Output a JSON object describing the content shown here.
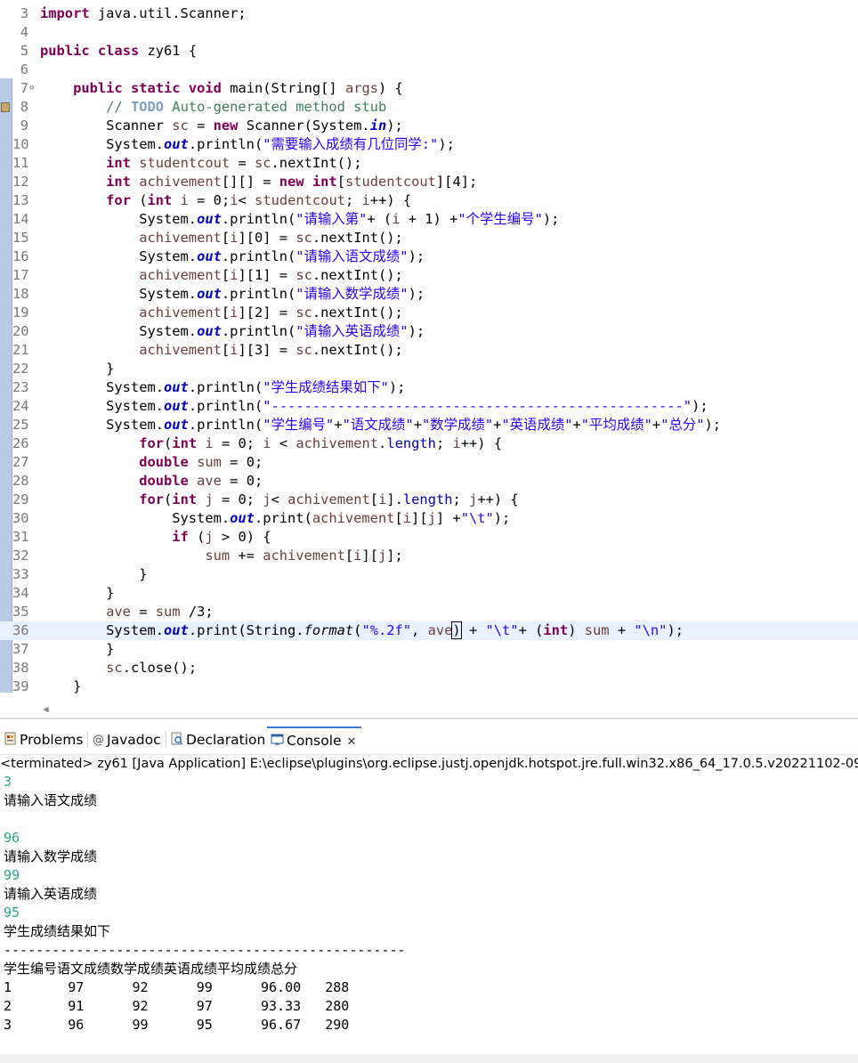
{
  "editor": {
    "lines": [
      {
        "n": "3",
        "html": "<span class=\"kw\">import</span> java.util.Scanner;"
      },
      {
        "n": "4",
        "html": ""
      },
      {
        "n": "5",
        "html": "<span class=\"kw\">public</span> <span class=\"kw\">class</span> zy61 {"
      },
      {
        "n": "6",
        "html": ""
      },
      {
        "n": "7",
        "fold": true,
        "html": "    <span class=\"kw\">public</span> <span class=\"kw\">static</span> <span class=\"kw\">void</span> main(String[] <span class=\"var\">args</span>) {"
      },
      {
        "n": "8",
        "marker": true,
        "html": "        <span class=\"cm\">// </span><span class=\"todo\">TODO</span><span class=\"cm\"> Auto-generated method stub</span>"
      },
      {
        "n": "9",
        "html": "        Scanner <span class=\"var\">sc</span> = <span class=\"kw\">new</span> Scanner(System.<span class=\"sfld\">in</span>);"
      },
      {
        "n": "10",
        "html": "        System.<span class=\"sfld\">out</span>.println(<span class=\"str\">\"需要输入成绩有几位同学:\"</span>);"
      },
      {
        "n": "11",
        "html": "        <span class=\"kw\">int</span> <span class=\"var\">studentcout</span> = <span class=\"var\">sc</span>.nextInt();"
      },
      {
        "n": "12",
        "html": "        <span class=\"kw\">int</span> <span class=\"var\">achivement</span>[][] = <span class=\"kw\">new</span> <span class=\"kw\">int</span>[<span class=\"var\">studentcout</span>][4];"
      },
      {
        "n": "13",
        "html": "        <span class=\"kw\">for</span> (<span class=\"kw\">int</span> <span class=\"var\">i</span> = 0;<span class=\"var\">i</span>&lt; <span class=\"var\">studentcout</span>; <span class=\"var\">i</span>++) {"
      },
      {
        "n": "14",
        "html": "            System.<span class=\"sfld\">out</span>.println(<span class=\"str\">\"请输入第\"</span>+ (<span class=\"var\">i</span> + 1) +<span class=\"str\">\"个学生编号\"</span>);"
      },
      {
        "n": "15",
        "html": "            <span class=\"var\">achivement</span>[<span class=\"var\">i</span>][0] = <span class=\"var\">sc</span>.nextInt();"
      },
      {
        "n": "16",
        "html": "            System.<span class=\"sfld\">out</span>.println(<span class=\"str\">\"请输入语文成绩\"</span>);"
      },
      {
        "n": "17",
        "html": "            <span class=\"var\">achivement</span>[<span class=\"var\">i</span>][1] = <span class=\"var\">sc</span>.nextInt();"
      },
      {
        "n": "18",
        "html": "            System.<span class=\"sfld\">out</span>.println(<span class=\"str\">\"请输入数学成绩\"</span>);"
      },
      {
        "n": "19",
        "html": "            <span class=\"var\">achivement</span>[<span class=\"var\">i</span>][2] = <span class=\"var\">sc</span>.nextInt();"
      },
      {
        "n": "20",
        "html": "            System.<span class=\"sfld\">out</span>.println(<span class=\"str\">\"请输入英语成绩\"</span>);"
      },
      {
        "n": "21",
        "html": "            <span class=\"var\">achivement</span>[<span class=\"var\">i</span>][3] = <span class=\"var\">sc</span>.nextInt();"
      },
      {
        "n": "22",
        "html": "        }"
      },
      {
        "n": "23",
        "html": "        System.<span class=\"sfld\">out</span>.println(<span class=\"str\">\"学生成绩结果如下\"</span>);"
      },
      {
        "n": "24",
        "html": "        System.<span class=\"sfld\">out</span>.println(<span class=\"str\">\"--------------------------------------------------\"</span>);"
      },
      {
        "n": "25",
        "html": "        System.<span class=\"sfld\">out</span>.println(<span class=\"str\">\"学生编号\"</span>+<span class=\"str\">\"语文成绩\"</span>+<span class=\"str\">\"数学成绩\"</span>+<span class=\"str\">\"英语成绩\"</span>+<span class=\"str\">\"平均成绩\"</span>+<span class=\"str\">\"总分\"</span>);"
      },
      {
        "n": "26",
        "html": "            <span class=\"kw\">for</span>(<span class=\"kw\">int</span> <span class=\"var\">i</span> = 0; <span class=\"var\">i</span> &lt; <span class=\"var\">achivement</span>.<span class=\"fld\">length</span>; <span class=\"var\">i</span>++) {"
      },
      {
        "n": "27",
        "html": "            <span class=\"kw\">double</span> <span class=\"var\">sum</span> = 0;"
      },
      {
        "n": "28",
        "html": "            <span class=\"kw\">double</span> <span class=\"var\">ave</span> = 0;"
      },
      {
        "n": "29",
        "html": "            <span class=\"kw\">for</span>(<span class=\"kw\">int</span> <span class=\"var\">j</span> = 0; <span class=\"var\">j</span>&lt; <span class=\"var\">achivement</span>[<span class=\"var\">i</span>].<span class=\"fld\">length</span>; <span class=\"var\">j</span>++) {"
      },
      {
        "n": "30",
        "html": "                System.<span class=\"sfld\">out</span>.print(<span class=\"var\">achivement</span>[<span class=\"var\">i</span>][<span class=\"var\">j</span>] +<span class=\"str\">\"\\t\"</span>);"
      },
      {
        "n": "31",
        "html": "                <span class=\"kw\">if</span> (<span class=\"var\">j</span> &gt; 0) {"
      },
      {
        "n": "32",
        "html": "                    <span class=\"var\">sum</span> += <span class=\"var\">achivement</span>[<span class=\"var\">i</span>][<span class=\"var\">j</span>];"
      },
      {
        "n": "33",
        "html": "            }"
      },
      {
        "n": "34",
        "html": "        }"
      },
      {
        "n": "35",
        "html": "        <span class=\"var\">ave</span> = <span class=\"var\">sum</span> /3;"
      },
      {
        "n": "36",
        "current": true,
        "html": "        System.<span class=\"sfld\">out</span>.print(String.<span class=\"smeth\">format</span>(<span class=\"str\">\"%.2f\"</span>, <span class=\"var\">ave</span><span class=\"caret\">)</span> + <span class=\"str\">\"\\t\"</span>+ (<span class=\"kw\">int</span>) <span class=\"var\">sum</span> + <span class=\"str\">\"\\n\"</span>);"
      },
      {
        "n": "37",
        "html": "        }"
      },
      {
        "n": "38",
        "html": "        <span class=\"var\">sc</span>.close();"
      },
      {
        "n": "39",
        "html": "    }"
      }
    ]
  },
  "tabs": {
    "problems": "Problems",
    "javadoc": "Javadoc",
    "declaration": "Declaration",
    "console": "Console",
    "close_glyph": "✕",
    "javadoc_glyph": "@"
  },
  "console": {
    "header": "<terminated> zy61 [Java Application] E:\\eclipse\\plugins\\org.eclipse.justj.openjdk.hotspot.jre.full.win32.x86_64_17.0.5.v20221102-09",
    "lines": [
      {
        "text": "3",
        "kind": "input"
      },
      {
        "text": "请输入语文成绩",
        "kind": "cjk"
      },
      {
        "text": "",
        "kind": "out"
      },
      {
        "text": "96",
        "kind": "input"
      },
      {
        "text": "请输入数学成绩",
        "kind": "cjk"
      },
      {
        "text": "99",
        "kind": "input"
      },
      {
        "text": "请输入英语成绩",
        "kind": "cjk"
      },
      {
        "text": "95",
        "kind": "input"
      },
      {
        "text": "学生成绩结果如下",
        "kind": "cjk"
      },
      {
        "text": "--------------------------------------------------",
        "kind": "out"
      },
      {
        "text": "学生编号语文成绩数学成绩英语成绩平均成绩总分",
        "kind": "cjk"
      },
      {
        "text": "1       97      92      99      96.00   288",
        "kind": "out"
      },
      {
        "text": "2       91      92      97      93.33   280",
        "kind": "out"
      },
      {
        "text": "3       96      99      95      96.67   290",
        "kind": "out"
      }
    ]
  }
}
